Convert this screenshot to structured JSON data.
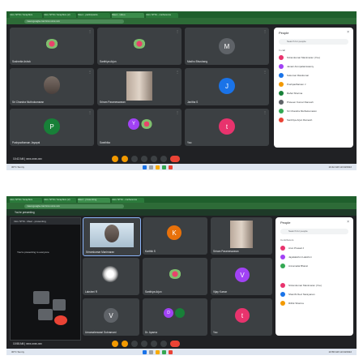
{
  "screenshot1": {
    "tabs": [
      "Intro NTSI / Graphics",
      "Intro NTSI / Graphics (2)",
      "Meet - participants",
      "Meet - video",
      "Intro NTSI - conference"
    ],
    "url": "meet.google.com/xxx-xxxx-xxx",
    "tiles": [
      {
        "name": "Sushmita Ashok",
        "kind": "flower"
      },
      {
        "name": "Santhiya Arjun",
        "kind": "flower"
      },
      {
        "name": "Madhu Bhushang",
        "kind": "letter",
        "letter": "M",
        "color": "#5f6368"
      },
      {
        "name": "Sri Chandra Muthukumaran",
        "kind": "photo"
      },
      {
        "name": "Sriram Parameswaran",
        "kind": "video"
      },
      {
        "name": "Janitha S",
        "kind": "letter",
        "letter": "J",
        "color": "#1a73e8"
      },
      {
        "name": "Pushpadharsan Jayapal",
        "kind": "letter",
        "letter": "P",
        "color": "#188038"
      },
      {
        "name": "Swathika",
        "kind": "pair",
        "letter": "Y",
        "color": "#a142f4"
      },
      {
        "name": "You",
        "kind": "letter",
        "letter": "t",
        "color": "#e8336d"
      }
    ],
    "panel": {
      "title": "People",
      "search_placeholder": "Search for people",
      "section": "In call",
      "people": [
        {
          "name": "Sriramkumar Manimaran (You)",
          "color": "#e8336d"
        },
        {
          "name": "Janani Arunpalaniswamy",
          "color": "#a142f4"
        },
        {
          "name": "Sukumar Ravikumar",
          "color": "#1a73e8"
        },
        {
          "name": "Pushpadharsan J",
          "color": "#f29900"
        },
        {
          "name": "Rahul Sharma",
          "color": "#188038"
        },
        {
          "name": "Praveen Kumar Ramesh",
          "color": "#5f6368"
        },
        {
          "name": "Sri Chandra Muthukumaran",
          "color": "#34a853"
        },
        {
          "name": "Santhiya Arjun Ramesh",
          "color": "#ea4335"
        }
      ]
    },
    "meeting_info": "10:42 AM | xxxx-xxxx-xxx",
    "taskbar": {
      "weather": "30°C Sunny",
      "clock": "10:42 AM 12/10/2022"
    }
  },
  "screenshot2": {
    "tabs": [
      "Intro NTSI / Graphics",
      "Intro NTSI / Graphics (2)",
      "Meet - presenting",
      "Intro NTSI - conference"
    ],
    "url": "meet.google.com/xxx-xxxx-xxx",
    "presenting_label": "You're presenting",
    "share_strip": "Intro NTSI - Meet - presenting",
    "share_text": "You're presenting to everyone",
    "tiles": [
      {
        "name": "Sriramkumar Manimaran",
        "kind": "video"
      },
      {
        "name": "Karthik S",
        "kind": "letter",
        "letter": "K",
        "color": "#e8710a"
      },
      {
        "name": "Sriram Parameswaran",
        "kind": "photo"
      },
      {
        "name": "Lakshmi R",
        "kind": "glow"
      },
      {
        "name": "Santhiya Arjun",
        "kind": "flower"
      },
      {
        "name": "Vijay Kumar",
        "kind": "letter",
        "letter": "V",
        "color": "#a142f4"
      },
      {
        "name": "Umamaheswari Subramani",
        "kind": "letter",
        "letter": "V",
        "color": "#5f6368"
      },
      {
        "name": "Dr. Aparna",
        "kind": "pair",
        "letter": "D",
        "color": "#a142f4"
      },
      {
        "name": "You",
        "kind": "letter",
        "letter": "t",
        "color": "#e8336d"
      }
    ],
    "panel": {
      "title": "People",
      "search_placeholder": "Search for people",
      "section": "Contributors",
      "people": [
        {
          "name": "Arun Prasad J",
          "color": "#e8336d"
        },
        {
          "name": "Jayalakshmi Lakshmi",
          "color": "#a142f4"
        },
        {
          "name": "Annamalai Bharat",
          "color": "#34a853"
        },
        {
          "name": "Sriramkumar Manimaran (You)",
          "color": "#e8336d"
        },
        {
          "name": "Shanthi Devi Narayanan",
          "color": "#1a73e8"
        },
        {
          "name": "Rithik Sharma",
          "color": "#f29900"
        }
      ]
    },
    "meeting_info": "10:58 AM | xxxx-xxxx-xxx",
    "taskbar": {
      "weather": "30°C Sunny",
      "clock": "10:58 AM 12/10/2022"
    }
  }
}
